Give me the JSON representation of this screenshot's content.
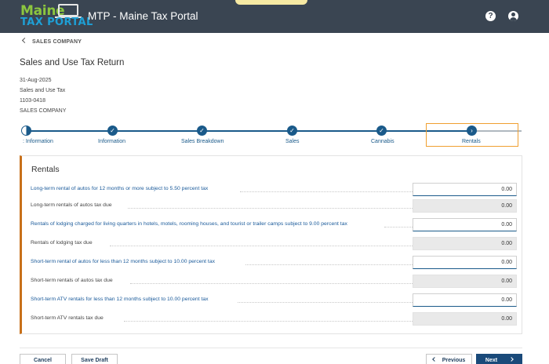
{
  "header": {
    "logo_top": "Maine",
    "logo_bottom": "TAX PORTAL",
    "title": "MTP - Maine Tax Portal",
    "toast": "",
    "help_icon": "help-icon",
    "user_icon": "user-icon",
    "help_glyph": "?"
  },
  "breadcrumb": {
    "label": "SALES COMPANY"
  },
  "page": {
    "title": "Sales and Use Tax Return",
    "meta": [
      "31-Aug-2025",
      "Sales and Use Tax",
      "1103-0418",
      "SALES COMPANY"
    ]
  },
  "stepper": {
    "steps": [
      {
        "label": ": Information",
        "state": "partial"
      },
      {
        "label": "Information",
        "state": "complete"
      },
      {
        "label": "Sales Breakdown",
        "state": "complete"
      },
      {
        "label": "Sales",
        "state": "complete"
      },
      {
        "label": "Cannabis",
        "state": "complete"
      },
      {
        "label": "Rentals",
        "state": "current"
      }
    ],
    "check_glyph": "✓",
    "current_glyph": "›"
  },
  "form": {
    "section_title": "Rentals",
    "rows": [
      {
        "label": "Long-term rental of autos for 12 months or more subject to 5.50 percent tax",
        "value": "0.00",
        "kind": "input"
      },
      {
        "label": "Long-term rentals of autos tax due",
        "value": "0.00",
        "kind": "readonly"
      },
      {
        "label": "Rentals of lodging charged for living quarters in hotels, motels, rooming houses, and tourist or trailer camps subject to 9.00 percent tax",
        "value": "0.00",
        "kind": "input"
      },
      {
        "label": "Rentals of lodging tax due",
        "value": "0.00",
        "kind": "readonly"
      },
      {
        "label": "Short-term rental of autos for less than 12 months subject to 10.00 percent tax",
        "value": "0.00",
        "kind": "input"
      },
      {
        "label": "Short-term rentals of autos tax due",
        "value": "0.00",
        "kind": "readonly"
      },
      {
        "label": "Short-term ATV rentals for less than 12 months subject to 10.00 percent tax",
        "value": "0.00",
        "kind": "input"
      },
      {
        "label": "Short-term ATV rentals tax due",
        "value": "0.00",
        "kind": "readonly"
      }
    ]
  },
  "actions": {
    "cancel": "Cancel",
    "save_draft": "Save Draft",
    "previous": "Previous",
    "next": "Next"
  },
  "colors": {
    "header_bg": "#3a4552",
    "accent": "#1a5a8a",
    "highlight": "#f0a030",
    "section_border": "#c8701a"
  }
}
